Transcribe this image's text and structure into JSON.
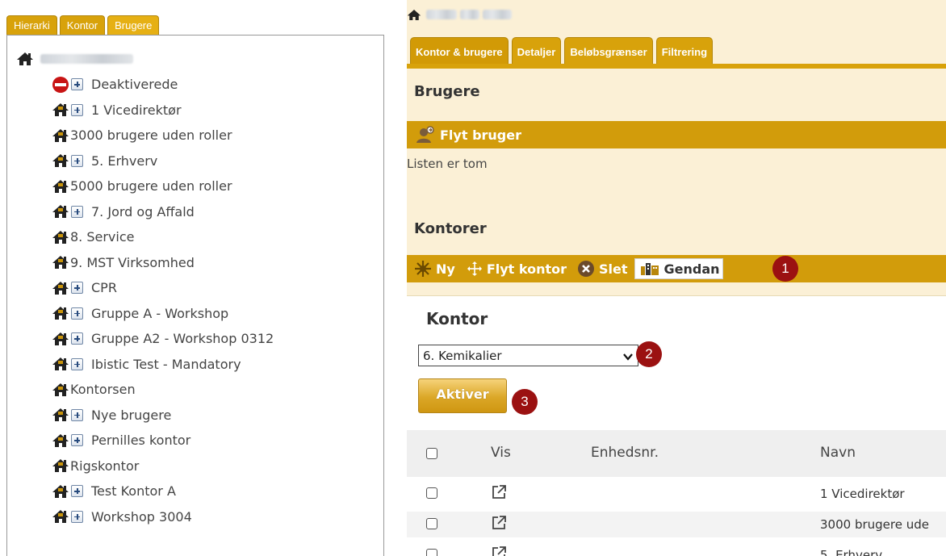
{
  "left_tabs": [
    "Hierarki",
    "Kontor",
    "Brugere"
  ],
  "tree": {
    "root_icon": "home-icon",
    "items": [
      {
        "label": "Deaktiverede",
        "icon": "no-entry-icon",
        "expandable": true
      },
      {
        "label": "1 Vicedirektør",
        "icon": "home-icon",
        "expandable": true
      },
      {
        "label": "3000 brugere uden roller",
        "icon": "home-icon",
        "expandable": false
      },
      {
        "label": "5. Erhverv",
        "icon": "home-icon",
        "expandable": true
      },
      {
        "label": "5000 brugere uden roller",
        "icon": "home-icon",
        "expandable": false
      },
      {
        "label": "7. Jord og Affald",
        "icon": "home-icon",
        "expandable": true
      },
      {
        "label": "8. Service",
        "icon": "home-icon",
        "expandable": false
      },
      {
        "label": "9. MST Virksomhed",
        "icon": "home-icon",
        "expandable": false
      },
      {
        "label": "CPR",
        "icon": "home-icon",
        "expandable": true
      },
      {
        "label": "Gruppe A - Workshop",
        "icon": "home-icon",
        "expandable": true
      },
      {
        "label": "Gruppe A2 - Workshop 0312",
        "icon": "home-icon",
        "expandable": true
      },
      {
        "label": "Ibistic Test - Mandatory",
        "icon": "home-icon",
        "expandable": true
      },
      {
        "label": "Kontorsen",
        "icon": "home-icon",
        "expandable": false
      },
      {
        "label": "Nye brugere",
        "icon": "home-icon",
        "expandable": true
      },
      {
        "label": "Pernilles kontor",
        "icon": "home-icon",
        "expandable": true
      },
      {
        "label": "Rigskontor",
        "icon": "home-icon",
        "expandable": false
      },
      {
        "label": "Test Kontor A",
        "icon": "home-icon",
        "expandable": true
      },
      {
        "label": "Workshop 3004",
        "icon": "home-icon",
        "expandable": true
      }
    ]
  },
  "right_tabs": [
    "Kontor & brugere",
    "Detaljer",
    "Beløbsgrænser",
    "Filtrering"
  ],
  "brugere": {
    "title": "Brugere",
    "move_user_label": "Flyt bruger",
    "empty_text": "Listen er tom"
  },
  "kontorer": {
    "title": "Kontorer",
    "new_label": "Ny",
    "move_label": "Flyt kontor",
    "delete_label": "Slet",
    "restore_label": "Gendan"
  },
  "kontor_form": {
    "title": "Kontor",
    "selected_office": "6. Kemikalier",
    "activate_label": "Aktiver"
  },
  "badges": [
    "1",
    "2",
    "3"
  ],
  "table": {
    "columns": [
      "Vis",
      "Enhedsnr.",
      "Navn"
    ],
    "rows": [
      {
        "name": "1 Vicedirektør"
      },
      {
        "name": "3000 brugere ude"
      },
      {
        "name": "5. Erhverv"
      }
    ]
  },
  "colors": {
    "gold": "#d29c0b",
    "tab_gold": "#d8a20b",
    "panel_bg": "#fbf0d6",
    "badge_red": "#9b1111"
  }
}
